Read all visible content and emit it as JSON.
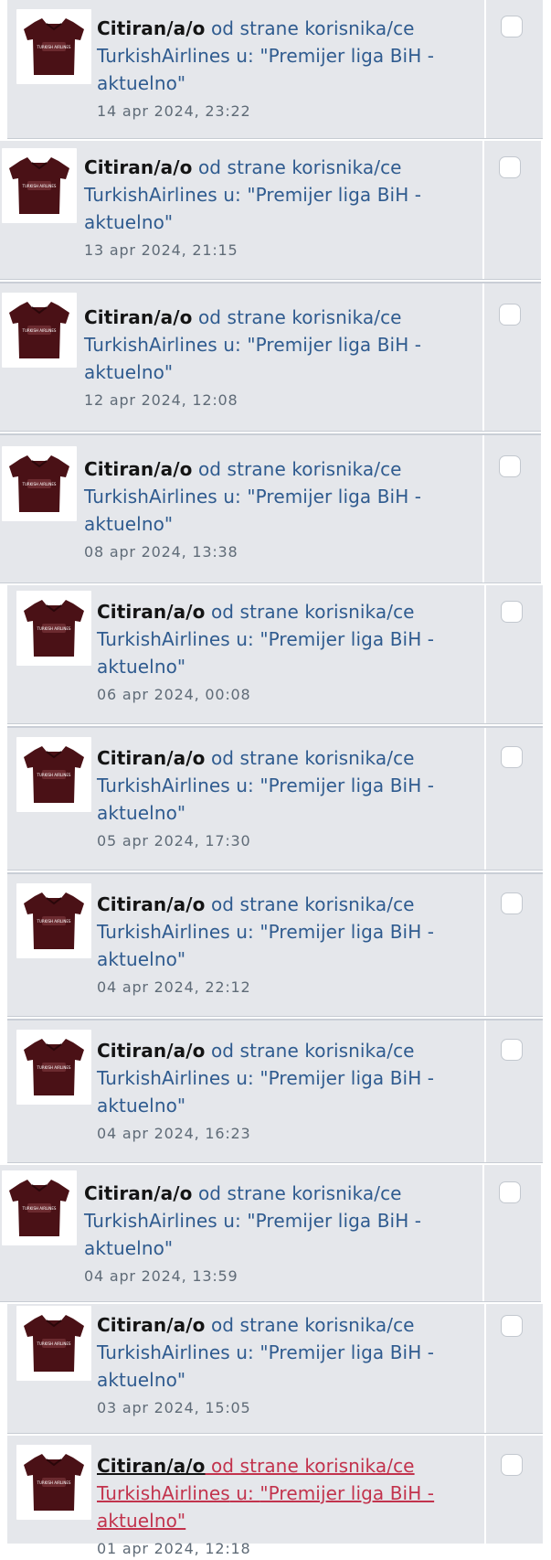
{
  "notifications": {
    "lead": "Citiran/a/o",
    "mid": " od strane korisnika/ce",
    "author": "TurkishAirlines",
    "mid2": " u: ",
    "topic": "\"Premijer liga BiH - aktuelno\"",
    "items": [
      {
        "time": "14 apr 2024, 23:22"
      },
      {
        "time": "13 apr 2024, 21:15"
      },
      {
        "time": "12 apr 2024, 12:08"
      },
      {
        "time": "08 apr 2024, 13:38"
      },
      {
        "time": "06 apr 2024, 00:08"
      },
      {
        "time": "05 apr 2024, 17:30"
      },
      {
        "time": "04 apr 2024, 22:12"
      },
      {
        "time": "04 apr 2024, 16:23"
      },
      {
        "time": "04 apr 2024, 13:59"
      },
      {
        "time": "03 apr 2024, 15:05"
      },
      {
        "time": "01 apr 2024, 12:18"
      }
    ]
  },
  "avatar": {
    "icon": "jersey-icon",
    "color": "#4a1116",
    "text": "TURKISH AIRLINES"
  }
}
